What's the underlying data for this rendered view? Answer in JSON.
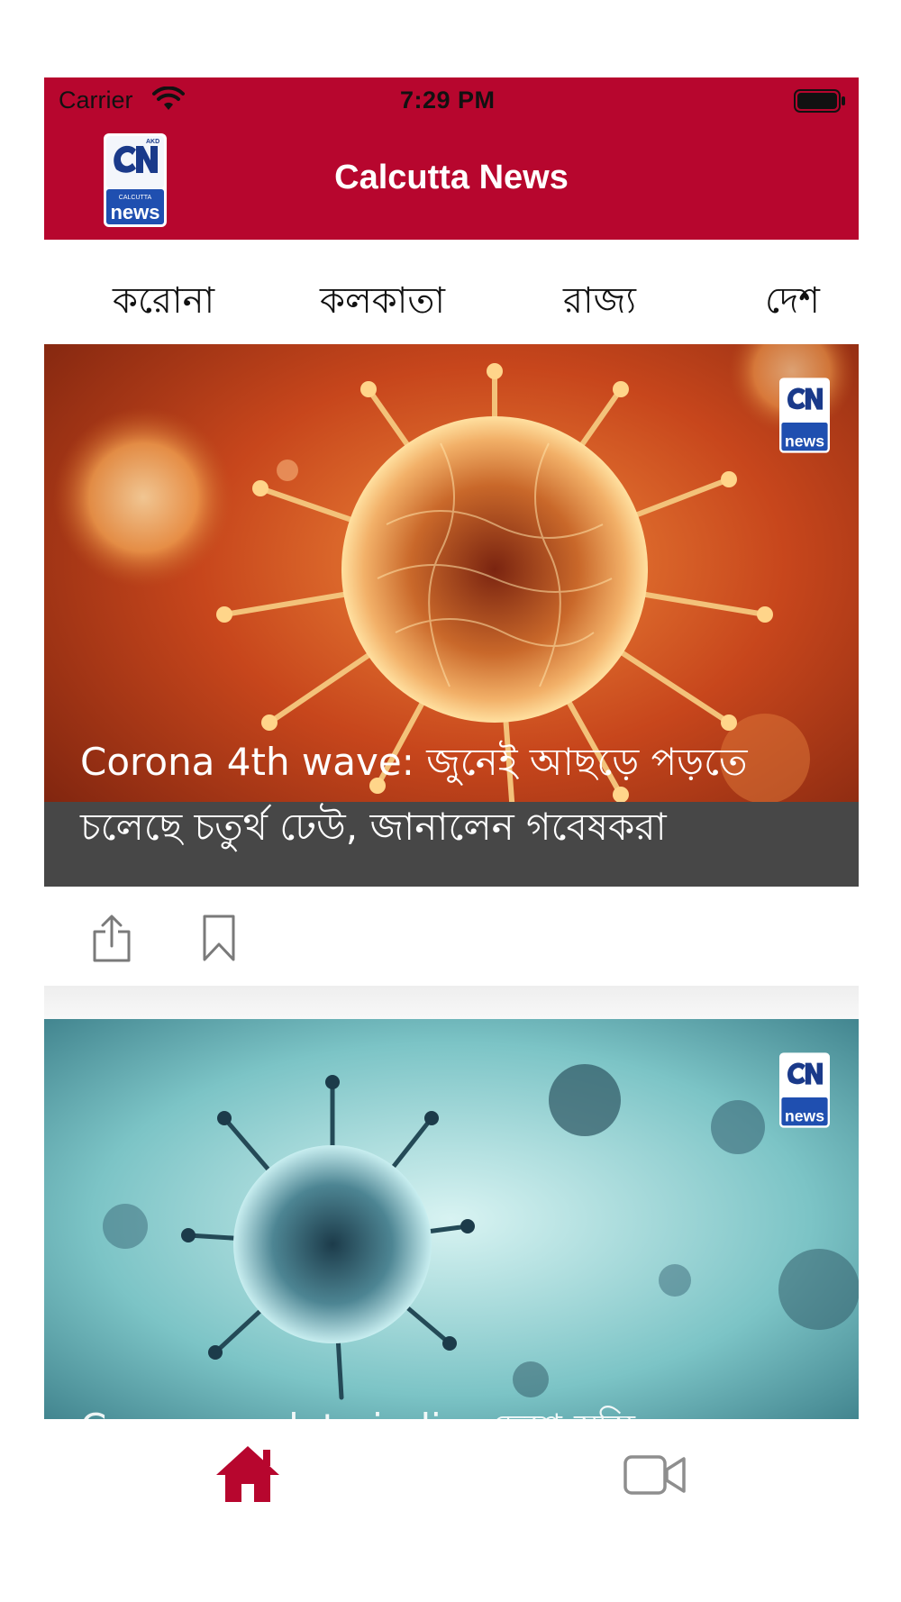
{
  "status": {
    "carrier": "Carrier",
    "time": "7:29 PM"
  },
  "app": {
    "title": "Calcutta News",
    "logo_icon": "calcutta-news-logo"
  },
  "tabs": [
    {
      "label": "করোনা",
      "selected": true
    },
    {
      "label": "কলকাতা",
      "selected": false
    },
    {
      "label": "রাজ্য",
      "selected": false
    },
    {
      "label": "দেশ",
      "selected": false
    }
  ],
  "articles": [
    {
      "headline": "Corona 4th wave: জুনেই আছড়ে পড়তে চলেছে চতুর্থ ঢেউ, জানালেন গবেষকরা",
      "image": "orange-coronavirus-illustration"
    },
    {
      "headline": "Corona update india: দেশে স্বস্তি",
      "image": "blue-coronavirus-illustration"
    }
  ],
  "actions": {
    "share_icon": "share-icon",
    "bookmark_icon": "bookmark-icon"
  },
  "bottom_nav": [
    {
      "name": "home",
      "icon": "home-icon",
      "active": true
    },
    {
      "name": "video",
      "icon": "video-icon",
      "active": false
    }
  ],
  "colors": {
    "brand": "#b7062e",
    "inactive_icon": "#8e8e8e"
  }
}
